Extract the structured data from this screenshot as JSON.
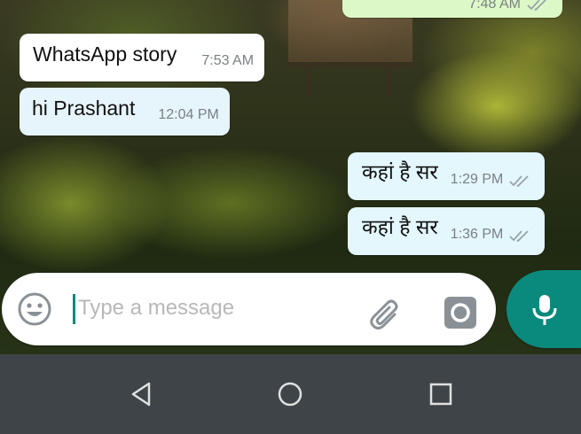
{
  "conversation": {
    "messages": [
      {
        "direction": "outgoing",
        "text": "",
        "time": "7:48 AM",
        "status": "read-ticks"
      },
      {
        "direction": "incoming",
        "text": "WhatsApp story",
        "time": "7:53 AM"
      },
      {
        "direction": "incoming",
        "text": "hi Prashant",
        "time": "12:04 PM"
      },
      {
        "direction": "outgoing",
        "text": "कहां है सर",
        "time": "1:29 PM",
        "status": "read-ticks"
      },
      {
        "direction": "outgoing",
        "text": "कहां है सर",
        "time": "1:36 PM",
        "status": "read-ticks"
      }
    ]
  },
  "composer": {
    "placeholder": "Type a message",
    "value": "",
    "emoji_icon": "emoji-icon",
    "attach_icon": "paperclip-icon",
    "camera_icon": "camera-icon",
    "mic_icon": "microphone-icon"
  },
  "navigation": {
    "back_icon": "back-triangle-icon",
    "home_icon": "home-circle-icon",
    "recents_icon": "recents-square-icon"
  },
  "colors": {
    "accent": "#0a8a7d",
    "outgoing_bubble": "#dcf8c6",
    "incoming_bubble": "#ffffff",
    "navbar": "#3f4448"
  }
}
